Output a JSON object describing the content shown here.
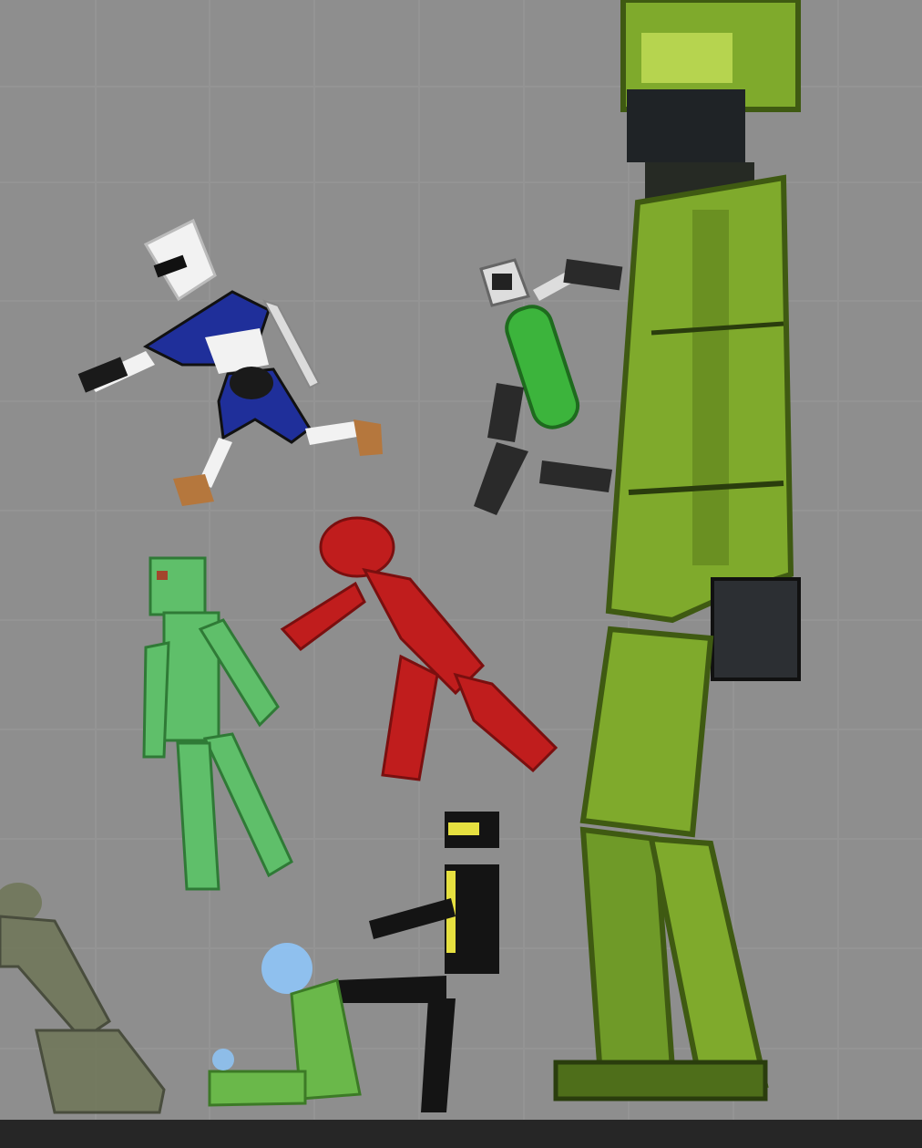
{
  "scene": {
    "background": "#8e8e8e",
    "grid_line_color": "#9a9a9a",
    "ground_color": "#262626"
  },
  "characters": [
    {
      "name": "giant-green-soldier",
      "colors": {
        "body": "#7faa2c",
        "dark": "#5c7f1d",
        "visor": "#1f2326"
      }
    },
    {
      "name": "blue-white-ninja",
      "colors": {
        "shirt": "#1f2f9a",
        "white": "#f2f2f2",
        "skin": "#b5773d"
      }
    },
    {
      "name": "green-tank-ragdoll",
      "colors": {
        "tank": "#3cb43c",
        "limbs": "#2a2a2a"
      }
    },
    {
      "name": "red-ragdoll",
      "colors": {
        "body": "#c01d1d"
      }
    },
    {
      "name": "green-zombie",
      "colors": {
        "body": "#5fbf6a"
      }
    },
    {
      "name": "black-suit-ragdoll",
      "colors": {
        "suit": "#141414",
        "accent": "#e6e040"
      }
    },
    {
      "name": "sitting-green-ragdoll",
      "colors": {
        "body": "#6ab84a",
        "head": "#8fc9ff"
      }
    },
    {
      "name": "faded-olive-ragdoll",
      "colors": {
        "body": "#6f7657"
      }
    }
  ]
}
